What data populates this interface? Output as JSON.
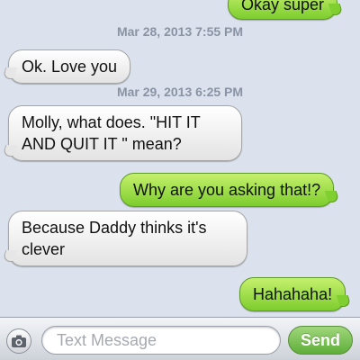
{
  "messages": [
    {
      "type": "outgoing",
      "text": "Okay super"
    },
    {
      "type": "timestamp",
      "text": "Mar 28, 2013 7:55 PM"
    },
    {
      "type": "incoming",
      "text": "Ok. Love you"
    },
    {
      "type": "timestamp",
      "text": "Mar 29, 2013 6:25 PM"
    },
    {
      "type": "incoming",
      "text": "Molly, what does. \"HIT IT AND QUIT IT \" mean?"
    },
    {
      "type": "outgoing",
      "text": "Why are you asking that!?"
    },
    {
      "type": "incoming",
      "text": "Because Daddy thinks it's clever"
    },
    {
      "type": "outgoing",
      "text": "Hahahaha!"
    }
  ],
  "composer": {
    "placeholder": "Text Message",
    "send_label": "Send",
    "camera_icon": "camera-icon"
  },
  "colors": {
    "background": "#dbe2ed",
    "outgoing_bubble": "#8fd444",
    "incoming_bubble": "#f0f0f0",
    "send_button": "#6db548"
  }
}
